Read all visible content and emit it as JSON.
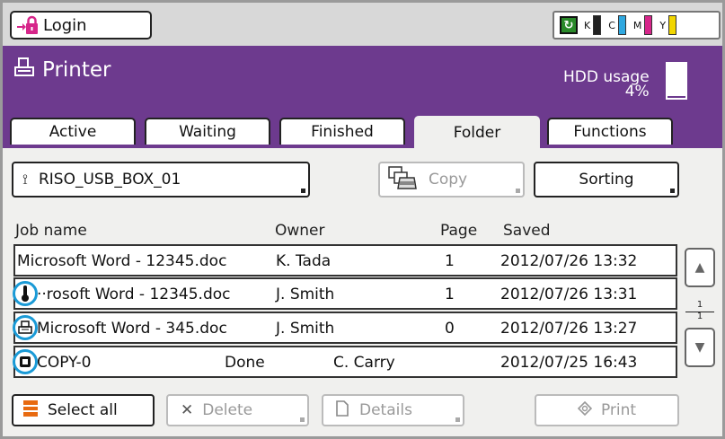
{
  "topbar": {
    "login_label": "Login",
    "ink": {
      "eco_symbol": "↻",
      "k": "K",
      "c": "C",
      "m": "M",
      "y": "Y",
      "colors": {
        "k": "#222222",
        "c": "#2fa8e0",
        "m": "#d6268a",
        "y": "#f2d600"
      }
    }
  },
  "header": {
    "title": "Printer",
    "hdd_label": "HDD usage",
    "hdd_value": "4%",
    "hdd_fraction": 0.04,
    "accent": "#6d3a8e"
  },
  "tabs": [
    {
      "label": "Active"
    },
    {
      "label": "Waiting"
    },
    {
      "label": "Finished"
    },
    {
      "label": "Folder"
    },
    {
      "label": "Functions"
    }
  ],
  "folder": {
    "name": "RISO_USB_BOX_01",
    "copy_label": "Copy",
    "sorting_label": "Sorting"
  },
  "columns": {
    "job": "Job name",
    "owner": "Owner",
    "page": "Page",
    "saved": "Saved"
  },
  "rows": [
    {
      "job": "Microsoft Word - 12345.doc",
      "owner": "K. Tada",
      "page": "1",
      "saved": "2012/07/26 13:32",
      "icon": ""
    },
    {
      "job": "··rosoft Word - 12345.doc",
      "owner": "J. Smith",
      "page": "1",
      "saved": "2012/07/26 13:31",
      "icon": "thermometer-icon"
    },
    {
      "job": "Microsoft Word - 345.doc",
      "owner": "J. Smith",
      "page": "0",
      "saved": "2012/07/26 13:27",
      "icon": "printer-job-icon"
    },
    {
      "job": "COPY-0",
      "status": "Done",
      "owner": "C. Carry",
      "saved": "2012/07/25 16:43",
      "icon": "copy-job-icon"
    }
  ],
  "pager": {
    "current": "1",
    "total": "1"
  },
  "bottom": {
    "select_all": "Select all",
    "delete": "Delete",
    "details": "Details",
    "print": "Print"
  }
}
